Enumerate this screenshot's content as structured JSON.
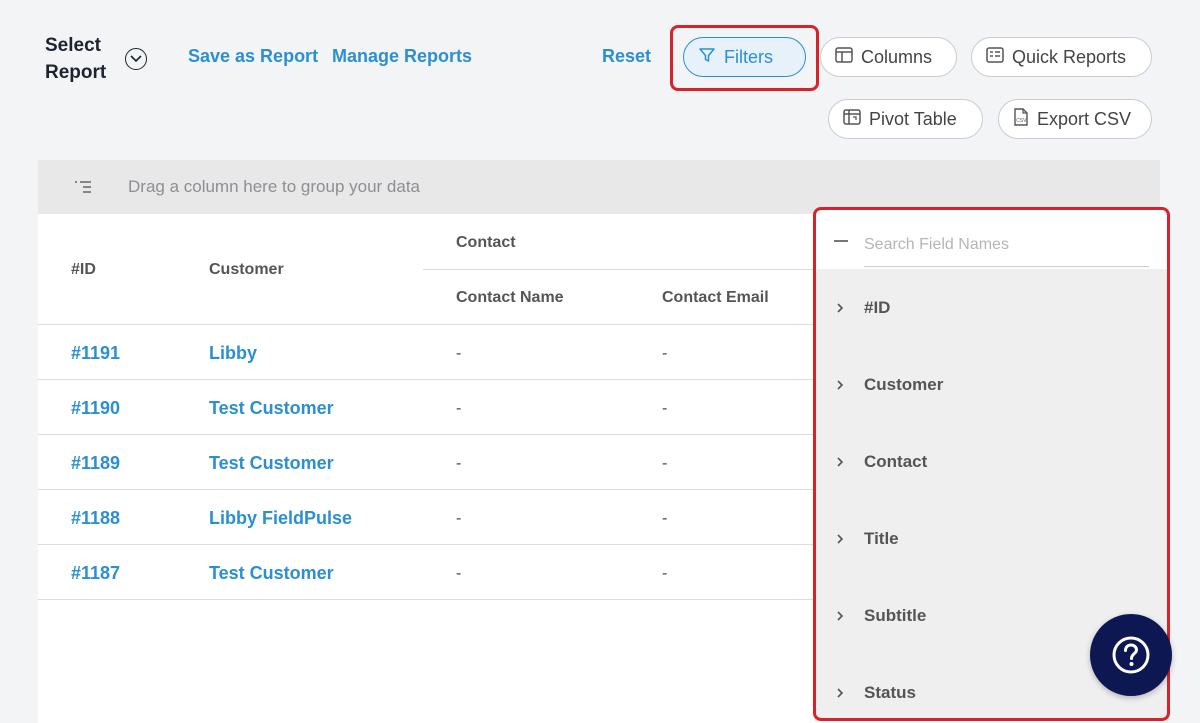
{
  "header": {
    "select_report_label": "Select Report",
    "save_as_report": "Save as Report",
    "manage_reports": "Manage Reports",
    "reset": "Reset",
    "filters": "Filters",
    "columns": "Columns",
    "quick_reports": "Quick Reports",
    "pivot_table": "Pivot Table",
    "export_csv": "Export CSV"
  },
  "group_bar": {
    "placeholder": "Drag a column here to group your data"
  },
  "table": {
    "headers": {
      "id": "#ID",
      "customer": "Customer",
      "contact": "Contact",
      "contact_name": "Contact Name",
      "contact_email": "Contact Email"
    },
    "rows": [
      {
        "id": "#1191",
        "customer": "Libby",
        "contact_name": "-",
        "contact_email": "-"
      },
      {
        "id": "#1190",
        "customer": "Test Customer",
        "contact_name": "-",
        "contact_email": "-"
      },
      {
        "id": "#1189",
        "customer": "Test Customer",
        "contact_name": "-",
        "contact_email": "-"
      },
      {
        "id": "#1188",
        "customer": "Libby FieldPulse",
        "contact_name": "-",
        "contact_email": "-"
      },
      {
        "id": "#1187",
        "customer": "Test Customer",
        "contact_name": "-",
        "contact_email": "-"
      }
    ]
  },
  "field_panel": {
    "search_placeholder": "Search Field Names",
    "fields": [
      "#ID",
      "Customer",
      "Contact",
      "Title",
      "Subtitle",
      "Status"
    ]
  },
  "colors": {
    "accent": "#2b8fd1",
    "highlight": "#d6232b",
    "help_button": "#0d1752"
  }
}
